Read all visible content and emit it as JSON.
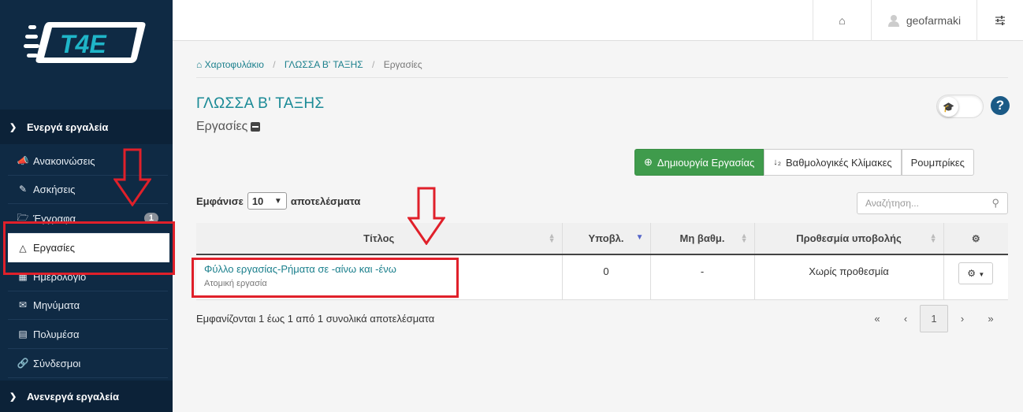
{
  "sidebar": {
    "logo_text": "T4E",
    "active_tools_label": "Ενεργά εργαλεία",
    "inactive_tools_label": "Ανενεργά εργαλεία",
    "items": [
      {
        "label": "Ανακοινώσεις",
        "icon": "megaphone-icon"
      },
      {
        "label": "Ασκήσεις",
        "icon": "edit-icon"
      },
      {
        "label": "Έγγραφα",
        "icon": "folder-icon",
        "badge": "1"
      },
      {
        "label": "Εργασίες",
        "icon": "flask-icon",
        "active": true
      },
      {
        "label": "Ημερολόγιο",
        "icon": "calendar-icon"
      },
      {
        "label": "Μηνύματα",
        "icon": "envelope-icon"
      },
      {
        "label": "Πολυμέσα",
        "icon": "film-icon"
      },
      {
        "label": "Σύνδεσμοι",
        "icon": "link-icon"
      }
    ]
  },
  "topbar": {
    "username": "geofarmaki"
  },
  "breadcrumb": {
    "home": "Χαρτοφυλάκιο",
    "course": "ΓΛΩΣΣΑ Β' ΤΑΞΗΣ",
    "current": "Εργασίες"
  },
  "page": {
    "course_title": "ΓΛΩΣΣΑ Β' ΤΑΞΗΣ",
    "subtitle": "Εργασίες"
  },
  "actions": {
    "create": "Δημιουργία Εργασίας",
    "grading_scales": "Βαθμολογικές Κλίμακες",
    "rubrics": "Ρουμπρίκες"
  },
  "table_controls": {
    "show_prefix": "Εμφάνισε",
    "page_size": "10",
    "show_suffix": "αποτελέσματα",
    "search_placeholder": "Αναζήτηση..."
  },
  "table": {
    "columns": [
      "Τίτλος",
      "Υποβλ.",
      "Μη βαθμ.",
      "Προθεσμία υποβολής"
    ],
    "rows": [
      {
        "title": "Φύλλο εργασίας-Ρήματα σε -αίνω και -ένω",
        "type": "Ατομική εργασία",
        "submissions": "0",
        "ungraded": "-",
        "deadline": "Χωρίς προθεσμία"
      }
    ]
  },
  "footer": {
    "info": "Εμφανίζονται 1 έως 1 από 1 συνολικά αποτελέσματα",
    "pager": {
      "first": "«",
      "prev": "‹",
      "current": "1",
      "next": "›",
      "last": "»"
    }
  },
  "colors": {
    "sidebar": "#0f2a44",
    "accent": "#1a8a96",
    "primary_button": "#3f9b4c",
    "annotation_red": "#e0202a"
  }
}
